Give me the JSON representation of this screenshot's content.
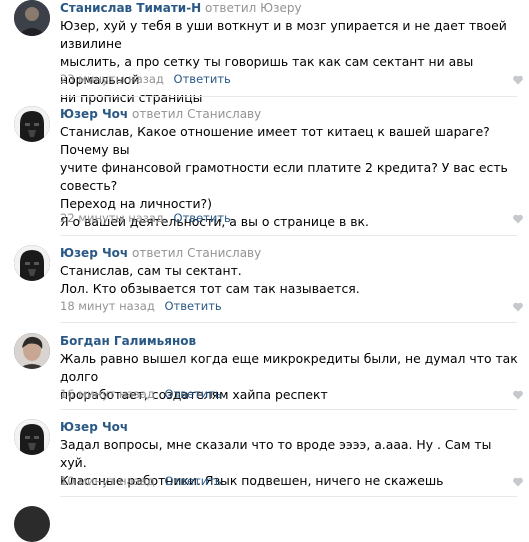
{
  "comments": [
    {
      "author": "Станислав Тимати-Н",
      "replied_verb": "ответил",
      "reply_to": "Юзеру",
      "text": "Юзер, хуй у тебя в уши воткнут и в мозг упирается и не дает твоей извилине\nмыслить, а про сетку ты говоришь так как сам сектант ни авы нормальной\nни прописи страницы",
      "time": "23 минуты назад",
      "reply_label": "Ответить",
      "avatar_icon": "user-avatar-photo"
    },
    {
      "author": "Юзер Чоч",
      "replied_verb": "ответил",
      "reply_to": "Станиславу",
      "text": "Станислав, Какое отношение имеет тот китаец к вашей шараге? Почему вы\nучите финансовой грамотности если платите 2 кредита? У вас есть\nсовесть?\nПереход на личности?)\nЯ о вашей деятельности, а вы о странице в вк.",
      "time": "22 минуты назад",
      "reply_label": "Ответить",
      "avatar_icon": "darth-vader-avatar"
    },
    {
      "author": "Юзер Чоч",
      "replied_verb": "ответил",
      "reply_to": "Станиславу",
      "text": "Станислав, сам ты сектант.\nЛол. Кто обзывается тот сам так называется.",
      "time": "18 минут назад",
      "reply_label": "Ответить",
      "avatar_icon": "darth-vader-avatar"
    },
    {
      "author": "Богдан Галимьянов",
      "replied_verb": "",
      "reply_to": "",
      "text": "Жаль равно вышел когда еще микрокредиты были, не думал что так долго\nпроработает, создателям хайпа респект",
      "time": "16 минут назад",
      "reply_label": "Ответить",
      "avatar_icon": "user-avatar-photo"
    },
    {
      "author": "Юзер Чоч",
      "replied_verb": "",
      "reply_to": "",
      "text": "Задал вопросы, мне сказали что то вроде ээээ, а.ааа. Ну . Сам ты хуй.\nКлассные работники. Язык подвешен, ничего не скажешь",
      "time": "10 минут назад",
      "reply_label": "Ответить",
      "avatar_icon": "darth-vader-avatar"
    }
  ],
  "colors": {
    "link": "#2a5885",
    "muted": "#939393",
    "divider": "#e7e8ec",
    "like_icon": "#c5c9ce"
  }
}
